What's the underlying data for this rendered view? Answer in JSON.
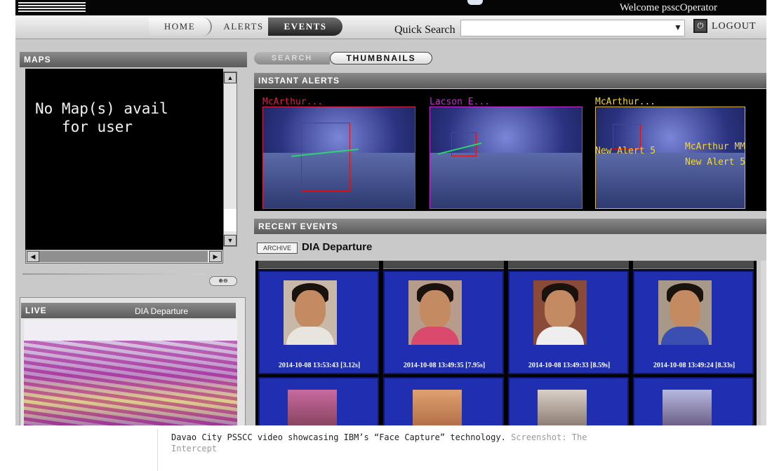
{
  "app": {
    "welcome": "Welcome psscOperator"
  },
  "nav": {
    "tabs": [
      "HOME",
      "ALERTS",
      "EVENTS"
    ],
    "active_tab": "EVENTS",
    "quick_search_label": "Quick Search",
    "quick_search_value": "",
    "logout_label": "LOGOUT"
  },
  "maps": {
    "header": "MAPS",
    "message": "No Map(s) avail\n   for user"
  },
  "live": {
    "header": "LIVE",
    "title": "DIA Departure"
  },
  "view_tabs": [
    "SEARCH",
    "THUMBNAILS"
  ],
  "instant_alerts": {
    "header": "INSTANT ALERTS",
    "items": [
      {
        "name": "McArthur...",
        "color": "#d3234a"
      },
      {
        "name": "Lacson E...",
        "color": "#c32fd0"
      },
      {
        "name": "McArthur...",
        "color": "#f2d83a"
      }
    ],
    "overlay_tags": [
      "New Alert 5",
      "McArthur MM",
      "New Alert 5"
    ]
  },
  "recent_events": {
    "header": "RECENT EVENTS",
    "archive_label": "ARCHIVE",
    "title": "DIA Departure",
    "thumbnails": [
      {
        "timestamp": "2014-10-08 13:53:43 [3.12s]",
        "shirt": "#e8e4de"
      },
      {
        "timestamp": "2014-10-08 13:49:35 [7.95s]",
        "shirt": "#d94a6c"
      },
      {
        "timestamp": "2014-10-08 13:49:33 [8.59s]",
        "shirt": "#eeeeee"
      },
      {
        "timestamp": "2014-10-08 13:49:24 [8.33s]",
        "shirt": "#3a4fb0"
      }
    ]
  },
  "caption": {
    "text": "Davao City PSSCC video showcasing IBM’s “Face Capture” technology.",
    "credit": "Screenshot: The Intercept"
  },
  "colors": {
    "panel_header": "#6e6e6e",
    "thumbnail_bg": "#1f2fb0",
    "alert_tag": "#f2d83a"
  }
}
